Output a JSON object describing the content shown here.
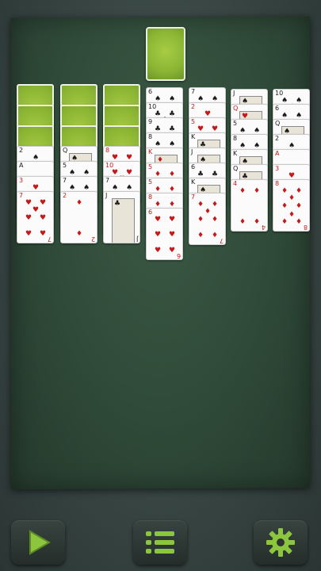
{
  "game": "Spider Solitaire",
  "colors": {
    "felt": "#2f4a38",
    "card_back": "#8ab634",
    "red_suit": "#c21b1b",
    "black_suit": "#1b1b1b"
  },
  "stock": {
    "icon": "card-back"
  },
  "columns": [
    {
      "hidden": 3,
      "cards": [
        {
          "r": "2",
          "s": "♠",
          "c": "black"
        },
        {
          "r": "A",
          "s": "♠",
          "c": "black"
        },
        {
          "r": "3",
          "s": "♥",
          "c": "red"
        },
        {
          "r": "7",
          "s": "♥",
          "c": "red"
        }
      ]
    },
    {
      "hidden": 3,
      "cards": [
        {
          "r": "Q",
          "s": "♠",
          "c": "black"
        },
        {
          "r": "5",
          "s": "♠",
          "c": "black"
        },
        {
          "r": "7",
          "s": "♠",
          "c": "black"
        },
        {
          "r": "2",
          "s": "♦",
          "c": "red"
        }
      ]
    },
    {
      "hidden": 3,
      "cards": [
        {
          "r": "8",
          "s": "♥",
          "c": "red"
        },
        {
          "r": "10",
          "s": "♥",
          "c": "red"
        },
        {
          "r": "7",
          "s": "♠",
          "c": "black"
        },
        {
          "r": "J",
          "s": "♣",
          "c": "black"
        }
      ]
    },
    {
      "hidden": 0,
      "cards": [
        {
          "r": "6",
          "s": "♠",
          "c": "black"
        },
        {
          "r": "10",
          "s": "♣",
          "c": "black"
        },
        {
          "r": "9",
          "s": "♣",
          "c": "black"
        },
        {
          "r": "8",
          "s": "♠",
          "c": "black"
        },
        {
          "r": "K",
          "s": "♦",
          "c": "red"
        },
        {
          "r": "5",
          "s": "♦",
          "c": "red"
        },
        {
          "r": "5",
          "s": "♦",
          "c": "red"
        },
        {
          "r": "8",
          "s": "♦",
          "c": "red"
        },
        {
          "r": "6",
          "s": "♥",
          "c": "red"
        }
      ]
    },
    {
      "hidden": 0,
      "cards": [
        {
          "r": "7",
          "s": "♠",
          "c": "black"
        },
        {
          "r": "2",
          "s": "♥",
          "c": "red"
        },
        {
          "r": "5",
          "s": "♥",
          "c": "red"
        },
        {
          "r": "K",
          "s": "♣",
          "c": "black"
        },
        {
          "r": "J",
          "s": "♠",
          "c": "black"
        },
        {
          "r": "6",
          "s": "♣",
          "c": "black"
        },
        {
          "r": "K",
          "s": "♠",
          "c": "black"
        },
        {
          "r": "7",
          "s": "♦",
          "c": "red"
        }
      ]
    },
    {
      "hidden": 0,
      "cards": [
        {
          "r": "J",
          "s": "♠",
          "c": "black"
        },
        {
          "r": "Q",
          "s": "♥",
          "c": "red"
        },
        {
          "r": "5",
          "s": "♠",
          "c": "black"
        },
        {
          "r": "8",
          "s": "♠",
          "c": "black"
        },
        {
          "r": "K",
          "s": "♠",
          "c": "black"
        },
        {
          "r": "Q",
          "s": "♣",
          "c": "black"
        },
        {
          "r": "4",
          "s": "♦",
          "c": "red"
        }
      ]
    },
    {
      "hidden": 0,
      "cards": [
        {
          "r": "10",
          "s": "♠",
          "c": "black"
        },
        {
          "r": "6",
          "s": "♠",
          "c": "black"
        },
        {
          "r": "Q",
          "s": "♠",
          "c": "black"
        },
        {
          "r": "2",
          "s": "♠",
          "c": "black"
        },
        {
          "r": "A",
          "s": "♥",
          "c": "red"
        },
        {
          "r": "3",
          "s": "♥",
          "c": "red"
        },
        {
          "r": "8",
          "s": "♦",
          "c": "red"
        }
      ]
    }
  ],
  "toolbar": [
    {
      "icon": "play-icon"
    },
    {
      "icon": "menu-list-icon"
    },
    {
      "icon": "gear-icon"
    }
  ]
}
